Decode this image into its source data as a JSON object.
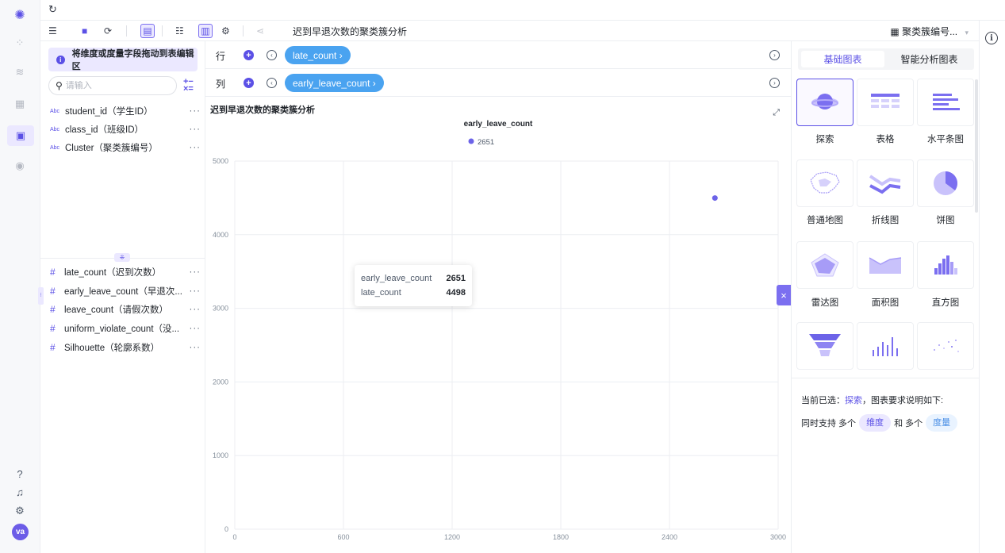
{
  "rail": {
    "icons": [
      "logo-icon",
      "apps-icon",
      "database-icon",
      "dashboard-icon",
      "folder-chart-icon",
      "compass-icon"
    ],
    "bottom_icons": [
      "help-icon",
      "bell-icon",
      "settings-icon"
    ],
    "avatar": "va"
  },
  "toolbar": {
    "title": "迟到早退次数的聚类簇分析",
    "select_value": "聚类簇编号...",
    "select_icon": "grid-icon"
  },
  "fields_panel": {
    "hint": "将维度或度量字段拖动到表编辑区",
    "search_placeholder": "请输入",
    "dimensions": [
      {
        "type": "Abc",
        "name": "student_id（学生ID）"
      },
      {
        "type": "Abc",
        "name": "class_id（班级ID）"
      },
      {
        "type": "Abc",
        "name": "Cluster（聚类簇编号）"
      }
    ],
    "measures": [
      {
        "type": "#",
        "name": "late_count（迟到次数）"
      },
      {
        "type": "#",
        "name": "early_leave_count（早退次..."
      },
      {
        "type": "#",
        "name": "leave_count（请假次数）"
      },
      {
        "type": "#",
        "name": "uniform_violate_count（没..."
      },
      {
        "type": "#",
        "name": "Silhouette（轮廓系数）"
      }
    ],
    "more": "···"
  },
  "shelves": {
    "row_label": "行",
    "row_pill": "late_count ›",
    "col_label": "列",
    "col_pill": "early_leave_count ›"
  },
  "chart_title": "迟到早退次数的聚类簇分析",
  "chart_data": {
    "type": "scatter",
    "legend_title": "early_leave_count",
    "legend_entry": "2651",
    "legend_color": "#6c63e8",
    "xlim": [
      0,
      3000
    ],
    "ylim": [
      0,
      5000
    ],
    "x_ticks": [
      "0",
      "600",
      "1200",
      "1800",
      "2400",
      "3000"
    ],
    "y_ticks": [
      "0",
      "1000",
      "2000",
      "3000",
      "4000",
      "5000"
    ],
    "points": [
      {
        "x": 2651,
        "y": 4498
      }
    ],
    "grid": true
  },
  "tooltip": {
    "rows": [
      {
        "k": "early_leave_count",
        "v": "2651"
      },
      {
        "k": "late_count",
        "v": "4498"
      }
    ]
  },
  "chart_types": {
    "tabs": [
      "基础图表",
      "智能分析图表"
    ],
    "items": [
      "探索",
      "表格",
      "水平条图",
      "普通地图",
      "折线图",
      "饼图",
      "雷达图",
      "面积图",
      "直方图",
      "",
      "",
      ""
    ],
    "selected": "探索",
    "desc_prefix": "当前已选：",
    "desc_link": "探索",
    "desc_suffix": "，图表要求说明如下:",
    "req_prefix": "同时支持 多个",
    "req_dim": "维度",
    "req_mid": "和 多个",
    "req_mea": "度量"
  }
}
